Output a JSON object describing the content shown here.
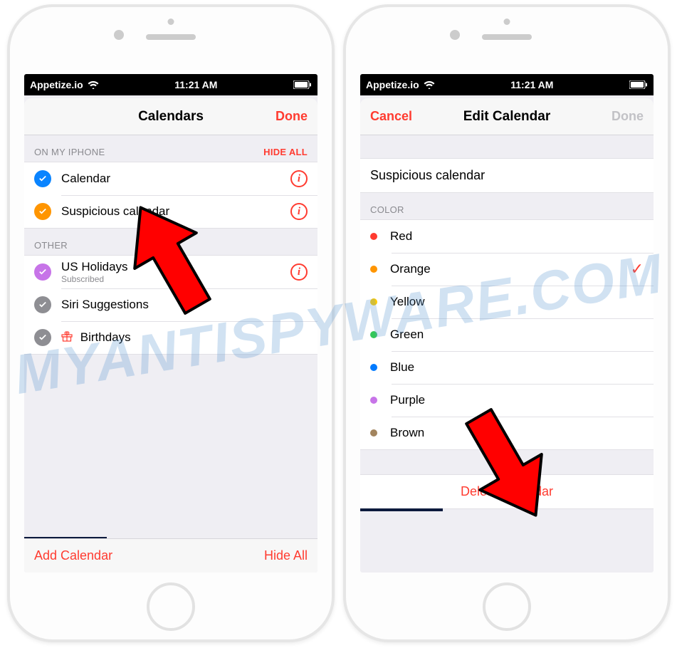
{
  "watermark": "MYANTISPYWARE.COM",
  "status": {
    "carrier": "Appetize.io",
    "time": "11:21 AM"
  },
  "left": {
    "nav": {
      "title": "Calendars",
      "done": "Done"
    },
    "section1": {
      "header": "ON MY IPHONE",
      "hide": "HIDE ALL",
      "items": [
        {
          "label": "Calendar",
          "color": "#0a84ff"
        },
        {
          "label": "Suspicious calendar",
          "color": "#ff9500"
        }
      ]
    },
    "section2": {
      "header": "OTHER",
      "items": [
        {
          "label": "US Holidays",
          "sub": "Subscribed",
          "color": "#c774e8"
        },
        {
          "label": "Siri Suggestions",
          "color": "#8e8e93"
        },
        {
          "label": "Birthdays",
          "color": "#8e8e93",
          "gift": true
        }
      ]
    },
    "toolbar": {
      "add": "Add Calendar",
      "hide": "Hide All"
    }
  },
  "right": {
    "nav": {
      "cancel": "Cancel",
      "title": "Edit Calendar",
      "done": "Done"
    },
    "name_value": "Suspicious calendar",
    "color_header": "COLOR",
    "colors": [
      {
        "label": "Red",
        "hex": "#ff3b30",
        "selected": false
      },
      {
        "label": "Orange",
        "hex": "#ff9500",
        "selected": true
      },
      {
        "label": "Yellow",
        "hex": "#ffcc00",
        "selected": false
      },
      {
        "label": "Green",
        "hex": "#34c759",
        "selected": false
      },
      {
        "label": "Blue",
        "hex": "#007aff",
        "selected": false
      },
      {
        "label": "Purple",
        "hex": "#c774e8",
        "selected": false
      },
      {
        "label": "Brown",
        "hex": "#a2845e",
        "selected": false
      }
    ],
    "delete": "Delete Calendar"
  }
}
